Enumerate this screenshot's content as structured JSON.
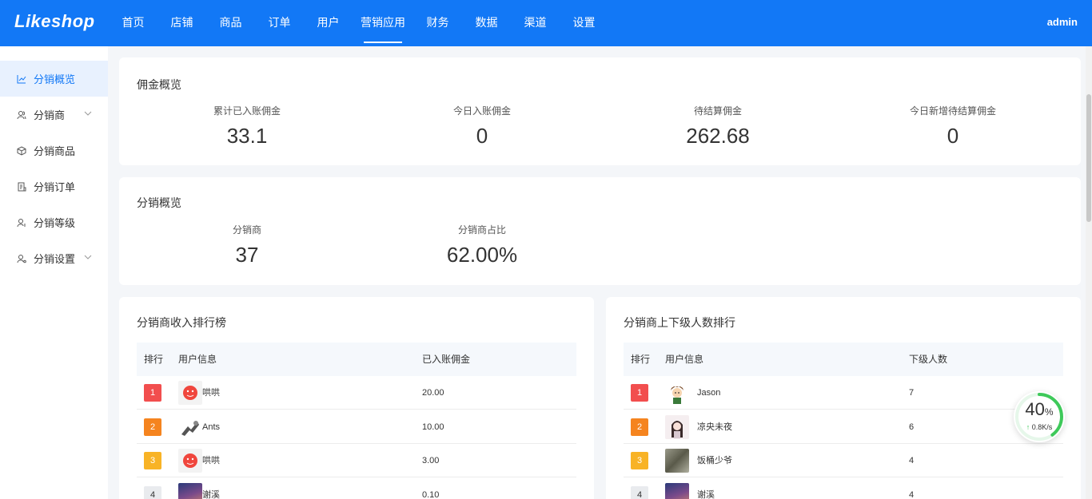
{
  "header": {
    "logo": "Likeshop",
    "nav": [
      {
        "label": "首页"
      },
      {
        "label": "店铺"
      },
      {
        "label": "商品"
      },
      {
        "label": "订单"
      },
      {
        "label": "用户"
      },
      {
        "label": "营销应用"
      },
      {
        "label": "财务"
      },
      {
        "label": "数据"
      },
      {
        "label": "渠道"
      },
      {
        "label": "设置"
      }
    ],
    "user": "admin"
  },
  "sidebar": {
    "items": [
      {
        "label": "分销概览"
      },
      {
        "label": "分销商"
      },
      {
        "label": "分销商品"
      },
      {
        "label": "分销订单"
      },
      {
        "label": "分销等级"
      },
      {
        "label": "分销设置"
      }
    ]
  },
  "commission": {
    "title": "佣金概览",
    "stats": [
      {
        "label": "累计已入账佣金",
        "value": "33.1"
      },
      {
        "label": "今日入账佣金",
        "value": "0"
      },
      {
        "label": "待结算佣金",
        "value": "262.68"
      },
      {
        "label": "今日新增待结算佣金",
        "value": "0"
      }
    ]
  },
  "distribution": {
    "title": "分销概览",
    "stats": [
      {
        "label": "分销商",
        "value": "37"
      },
      {
        "label": "分销商占比",
        "value": "62.00%"
      }
    ]
  },
  "income_rank": {
    "title": "分销商收入排行榜",
    "columns": [
      "排行",
      "用户信息",
      "已入账佣金"
    ],
    "rows": [
      {
        "rank": "1",
        "name": "哄哄",
        "value": "20.00"
      },
      {
        "rank": "2",
        "name": "Ants",
        "value": "10.00"
      },
      {
        "rank": "3",
        "name": "哄哄",
        "value": "3.00"
      },
      {
        "rank": "4",
        "name": "谢溪",
        "value": "0.10"
      }
    ]
  },
  "member_rank": {
    "title": "分销商上下级人数排行",
    "columns": [
      "排行",
      "用户信息",
      "下级人数"
    ],
    "rows": [
      {
        "rank": "1",
        "name": "Jason",
        "value": "7"
      },
      {
        "rank": "2",
        "name": "凉央未夜",
        "value": "6"
      },
      {
        "rank": "3",
        "name": "饭桶少爷",
        "value": "4"
      },
      {
        "rank": "4",
        "name": "谢溪",
        "value": "4"
      }
    ]
  },
  "speed_widget": {
    "percent": "40",
    "percent_unit": "%",
    "rate": "0.8K/s"
  },
  "colors": {
    "primary": "#1278f6",
    "rank1": "#f24e4e",
    "rank2": "#f5841f",
    "rank3": "#f8b326",
    "rank4": "#e9ebee"
  }
}
